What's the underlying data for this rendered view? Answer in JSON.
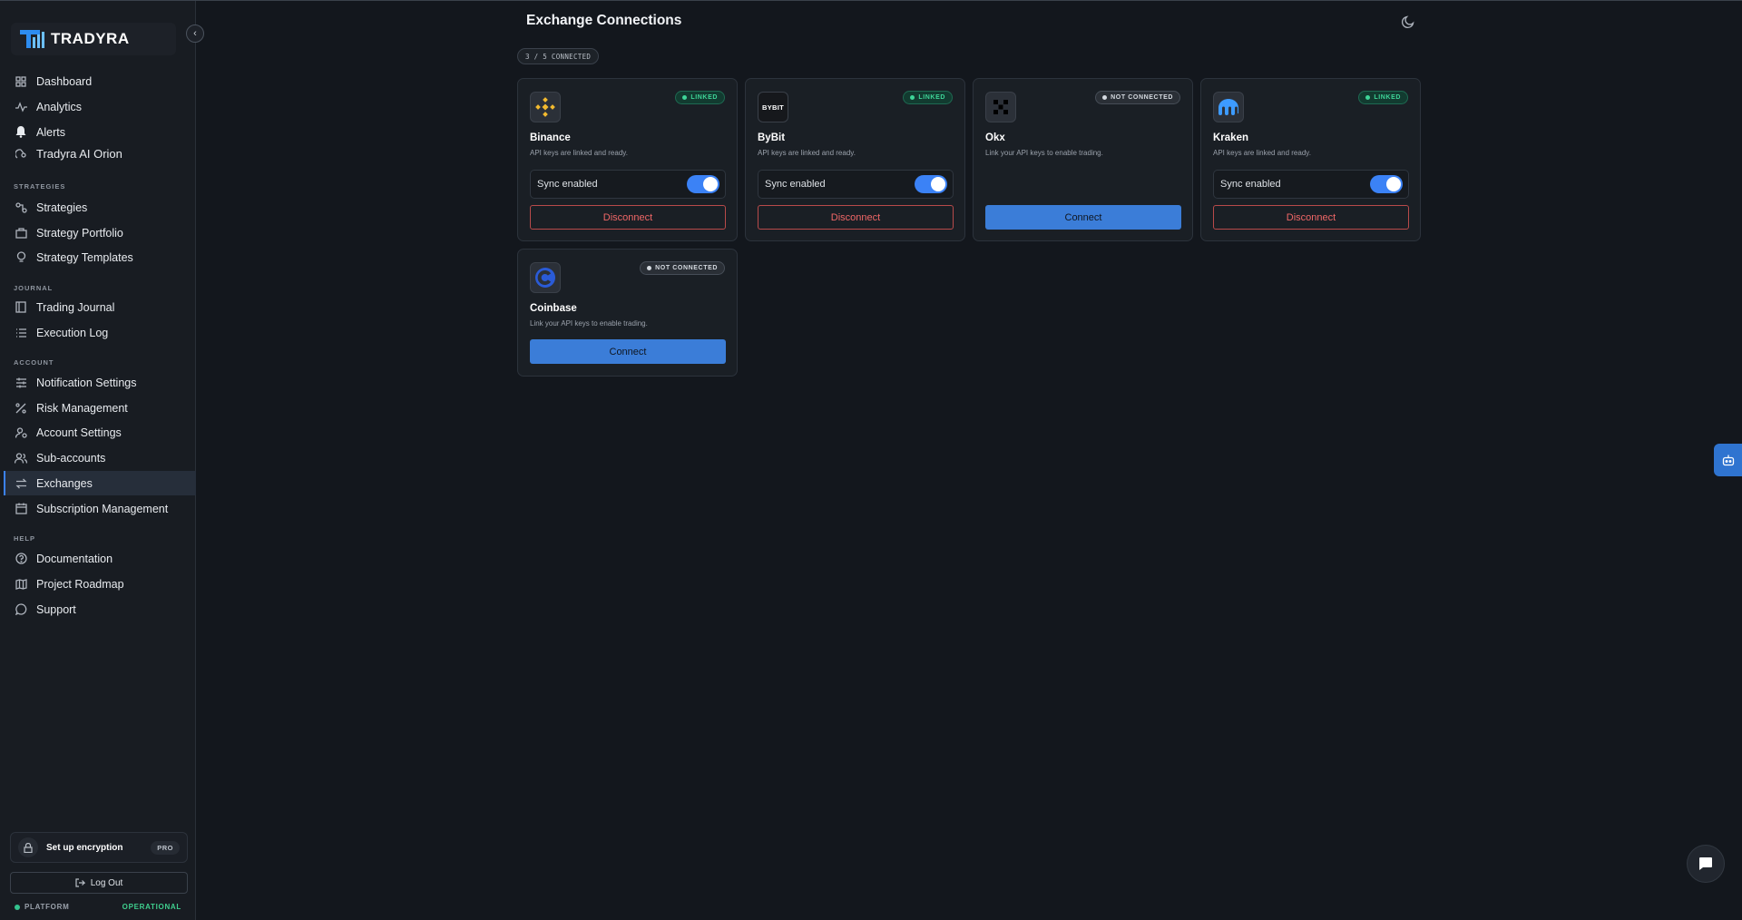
{
  "brand": {
    "name": "TRADYRA"
  },
  "sidebar": {
    "items_top": [
      {
        "label": "Dashboard"
      },
      {
        "label": "Analytics"
      },
      {
        "label": "Alerts"
      },
      {
        "label": "Tradyra AI Orion"
      }
    ],
    "sections": {
      "strategies": "STRATEGIES",
      "journal": "JOURNAL",
      "account": "ACCOUNT",
      "help": "HELP"
    },
    "strategies": [
      {
        "label": "Strategies"
      },
      {
        "label": "Strategy Portfolio"
      },
      {
        "label": "Strategy Templates"
      }
    ],
    "journal": [
      {
        "label": "Trading Journal"
      },
      {
        "label": "Execution Log"
      }
    ],
    "account": [
      {
        "label": "Notification Settings"
      },
      {
        "label": "Risk Management"
      },
      {
        "label": "Account Settings"
      },
      {
        "label": "Sub-accounts"
      },
      {
        "label": "Exchanges"
      },
      {
        "label": "Subscription Management"
      }
    ],
    "help": [
      {
        "label": "Documentation"
      },
      {
        "label": "Project Roadmap"
      },
      {
        "label": "Support"
      }
    ],
    "encryption": {
      "label": "Set up encryption",
      "badge": "PRO"
    },
    "logout": "Log Out",
    "platform": {
      "label": "PLATFORM",
      "status": "OPERATIONAL"
    }
  },
  "main": {
    "title": "Exchange Connections",
    "count_badge": "3 / 5 CONNECTED",
    "exchanges": [
      {
        "name": "Binance",
        "status": "LINKED",
        "desc": "API keys are linked and ready.",
        "sync_label": "Sync enabled",
        "action": "Disconnect"
      },
      {
        "name": "ByBit",
        "status": "LINKED",
        "desc": "API keys are linked and ready.",
        "sync_label": "Sync enabled",
        "action": "Disconnect",
        "logo_text": "BYBIT"
      },
      {
        "name": "Okx",
        "status": "NOT CONNECTED",
        "desc": "Link your API keys to enable trading.",
        "action": "Connect"
      },
      {
        "name": "Kraken",
        "status": "LINKED",
        "desc": "API keys are linked and ready.",
        "sync_label": "Sync enabled",
        "action": "Disconnect"
      },
      {
        "name": "Coinbase",
        "status": "NOT CONNECTED",
        "desc": "Link your API keys to enable trading.",
        "action": "Connect"
      }
    ]
  },
  "colors": {
    "accent": "#3b82f6",
    "linked": "#3ed598",
    "danger": "#f06767",
    "background": "#13171d"
  }
}
